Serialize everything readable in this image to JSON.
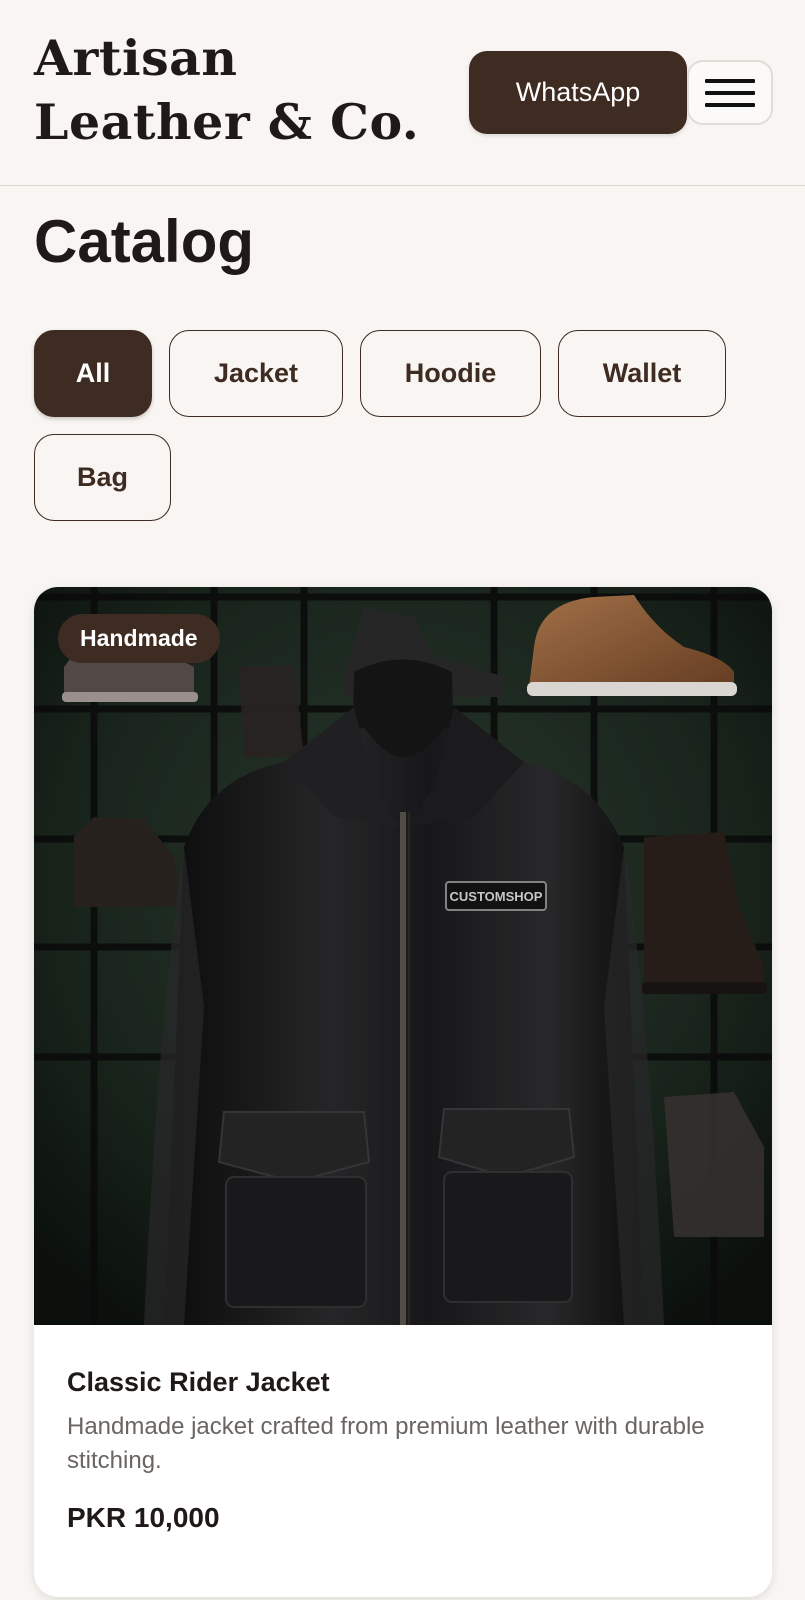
{
  "header": {
    "brand": "Artisan Leather & Co.",
    "whatsapp_label": "WhatsApp",
    "menu_icon": "hamburger-menu-icon"
  },
  "catalog": {
    "title": "Catalog",
    "filters": [
      {
        "label": "All",
        "selected": true
      },
      {
        "label": "Jacket",
        "selected": false
      },
      {
        "label": "Hoodie",
        "selected": false
      },
      {
        "label": "Wallet",
        "selected": false
      },
      {
        "label": "Bag",
        "selected": false
      }
    ]
  },
  "products": [
    {
      "badge": "Handmade",
      "name": "Classic Rider Jacket",
      "description": "Handmade jacket crafted from premium leather with durable stitching.",
      "price": "PKR 10,000",
      "image_patch_text": "CUSTOMSHOP"
    }
  ],
  "colors": {
    "background": "#f8f5f2",
    "accent": "#3e2b22",
    "text": "#1f1a17",
    "muted_text": "#6b6562",
    "card": "#ffffff"
  }
}
